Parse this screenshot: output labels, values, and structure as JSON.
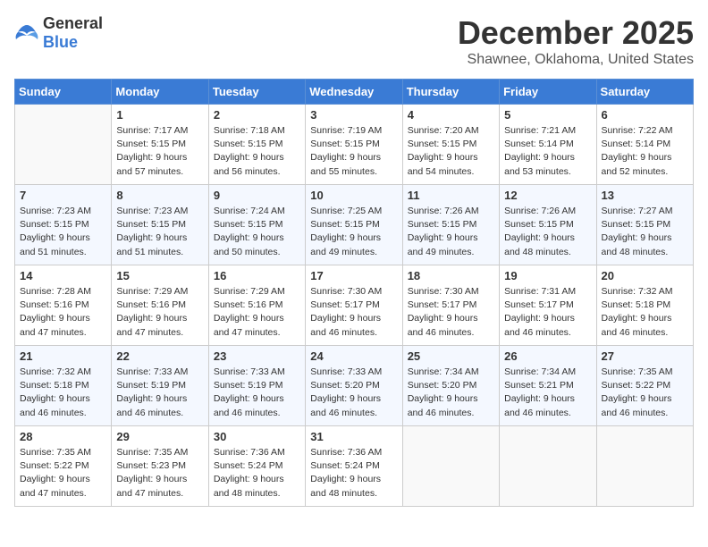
{
  "header": {
    "logo_general": "General",
    "logo_blue": "Blue",
    "month_title": "December 2025",
    "location": "Shawnee, Oklahoma, United States"
  },
  "days_of_week": [
    "Sunday",
    "Monday",
    "Tuesday",
    "Wednesday",
    "Thursday",
    "Friday",
    "Saturday"
  ],
  "weeks": [
    [
      {
        "day": "",
        "sunrise": "",
        "sunset": "",
        "daylight": ""
      },
      {
        "day": "1",
        "sunrise": "Sunrise: 7:17 AM",
        "sunset": "Sunset: 5:15 PM",
        "daylight": "Daylight: 9 hours and 57 minutes."
      },
      {
        "day": "2",
        "sunrise": "Sunrise: 7:18 AM",
        "sunset": "Sunset: 5:15 PM",
        "daylight": "Daylight: 9 hours and 56 minutes."
      },
      {
        "day": "3",
        "sunrise": "Sunrise: 7:19 AM",
        "sunset": "Sunset: 5:15 PM",
        "daylight": "Daylight: 9 hours and 55 minutes."
      },
      {
        "day": "4",
        "sunrise": "Sunrise: 7:20 AM",
        "sunset": "Sunset: 5:15 PM",
        "daylight": "Daylight: 9 hours and 54 minutes."
      },
      {
        "day": "5",
        "sunrise": "Sunrise: 7:21 AM",
        "sunset": "Sunset: 5:14 PM",
        "daylight": "Daylight: 9 hours and 53 minutes."
      },
      {
        "day": "6",
        "sunrise": "Sunrise: 7:22 AM",
        "sunset": "Sunset: 5:14 PM",
        "daylight": "Daylight: 9 hours and 52 minutes."
      }
    ],
    [
      {
        "day": "7",
        "sunrise": "Sunrise: 7:23 AM",
        "sunset": "Sunset: 5:15 PM",
        "daylight": "Daylight: 9 hours and 51 minutes."
      },
      {
        "day": "8",
        "sunrise": "Sunrise: 7:23 AM",
        "sunset": "Sunset: 5:15 PM",
        "daylight": "Daylight: 9 hours and 51 minutes."
      },
      {
        "day": "9",
        "sunrise": "Sunrise: 7:24 AM",
        "sunset": "Sunset: 5:15 PM",
        "daylight": "Daylight: 9 hours and 50 minutes."
      },
      {
        "day": "10",
        "sunrise": "Sunrise: 7:25 AM",
        "sunset": "Sunset: 5:15 PM",
        "daylight": "Daylight: 9 hours and 49 minutes."
      },
      {
        "day": "11",
        "sunrise": "Sunrise: 7:26 AM",
        "sunset": "Sunset: 5:15 PM",
        "daylight": "Daylight: 9 hours and 49 minutes."
      },
      {
        "day": "12",
        "sunrise": "Sunrise: 7:26 AM",
        "sunset": "Sunset: 5:15 PM",
        "daylight": "Daylight: 9 hours and 48 minutes."
      },
      {
        "day": "13",
        "sunrise": "Sunrise: 7:27 AM",
        "sunset": "Sunset: 5:15 PM",
        "daylight": "Daylight: 9 hours and 48 minutes."
      }
    ],
    [
      {
        "day": "14",
        "sunrise": "Sunrise: 7:28 AM",
        "sunset": "Sunset: 5:16 PM",
        "daylight": "Daylight: 9 hours and 47 minutes."
      },
      {
        "day": "15",
        "sunrise": "Sunrise: 7:29 AM",
        "sunset": "Sunset: 5:16 PM",
        "daylight": "Daylight: 9 hours and 47 minutes."
      },
      {
        "day": "16",
        "sunrise": "Sunrise: 7:29 AM",
        "sunset": "Sunset: 5:16 PM",
        "daylight": "Daylight: 9 hours and 47 minutes."
      },
      {
        "day": "17",
        "sunrise": "Sunrise: 7:30 AM",
        "sunset": "Sunset: 5:17 PM",
        "daylight": "Daylight: 9 hours and 46 minutes."
      },
      {
        "day": "18",
        "sunrise": "Sunrise: 7:30 AM",
        "sunset": "Sunset: 5:17 PM",
        "daylight": "Daylight: 9 hours and 46 minutes."
      },
      {
        "day": "19",
        "sunrise": "Sunrise: 7:31 AM",
        "sunset": "Sunset: 5:17 PM",
        "daylight": "Daylight: 9 hours and 46 minutes."
      },
      {
        "day": "20",
        "sunrise": "Sunrise: 7:32 AM",
        "sunset": "Sunset: 5:18 PM",
        "daylight": "Daylight: 9 hours and 46 minutes."
      }
    ],
    [
      {
        "day": "21",
        "sunrise": "Sunrise: 7:32 AM",
        "sunset": "Sunset: 5:18 PM",
        "daylight": "Daylight: 9 hours and 46 minutes."
      },
      {
        "day": "22",
        "sunrise": "Sunrise: 7:33 AM",
        "sunset": "Sunset: 5:19 PM",
        "daylight": "Daylight: 9 hours and 46 minutes."
      },
      {
        "day": "23",
        "sunrise": "Sunrise: 7:33 AM",
        "sunset": "Sunset: 5:19 PM",
        "daylight": "Daylight: 9 hours and 46 minutes."
      },
      {
        "day": "24",
        "sunrise": "Sunrise: 7:33 AM",
        "sunset": "Sunset: 5:20 PM",
        "daylight": "Daylight: 9 hours and 46 minutes."
      },
      {
        "day": "25",
        "sunrise": "Sunrise: 7:34 AM",
        "sunset": "Sunset: 5:20 PM",
        "daylight": "Daylight: 9 hours and 46 minutes."
      },
      {
        "day": "26",
        "sunrise": "Sunrise: 7:34 AM",
        "sunset": "Sunset: 5:21 PM",
        "daylight": "Daylight: 9 hours and 46 minutes."
      },
      {
        "day": "27",
        "sunrise": "Sunrise: 7:35 AM",
        "sunset": "Sunset: 5:22 PM",
        "daylight": "Daylight: 9 hours and 46 minutes."
      }
    ],
    [
      {
        "day": "28",
        "sunrise": "Sunrise: 7:35 AM",
        "sunset": "Sunset: 5:22 PM",
        "daylight": "Daylight: 9 hours and 47 minutes."
      },
      {
        "day": "29",
        "sunrise": "Sunrise: 7:35 AM",
        "sunset": "Sunset: 5:23 PM",
        "daylight": "Daylight: 9 hours and 47 minutes."
      },
      {
        "day": "30",
        "sunrise": "Sunrise: 7:36 AM",
        "sunset": "Sunset: 5:24 PM",
        "daylight": "Daylight: 9 hours and 48 minutes."
      },
      {
        "day": "31",
        "sunrise": "Sunrise: 7:36 AM",
        "sunset": "Sunset: 5:24 PM",
        "daylight": "Daylight: 9 hours and 48 minutes."
      },
      {
        "day": "",
        "sunrise": "",
        "sunset": "",
        "daylight": ""
      },
      {
        "day": "",
        "sunrise": "",
        "sunset": "",
        "daylight": ""
      },
      {
        "day": "",
        "sunrise": "",
        "sunset": "",
        "daylight": ""
      }
    ]
  ]
}
